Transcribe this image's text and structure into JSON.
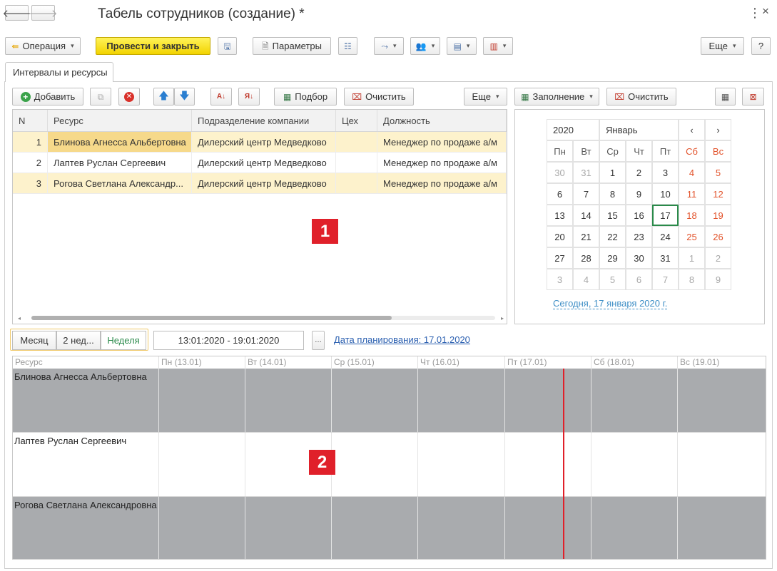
{
  "window": {
    "title": "Табель сотрудников (создание) *"
  },
  "toolbar": {
    "operation": "Операция",
    "post_close": "Провести и закрыть",
    "params": "Параметры",
    "more": "Еще",
    "help": "?"
  },
  "tabs": [
    {
      "label": "Интервалы и ресурсы"
    }
  ],
  "table_toolbar": {
    "add": "Добавить",
    "selection": "Подбор",
    "clear": "Очистить",
    "more": "Еще",
    "fill": "Заполнение",
    "clear2": "Очистить"
  },
  "table": {
    "columns": [
      "N",
      "Ресурс",
      "Подразделение компании",
      "Цех",
      "Должность"
    ],
    "rows": [
      {
        "n": "1",
        "resource": "Блинова Агнесса Альбертовна",
        "dept": "Дилерский центр Медведково",
        "shop": "",
        "position": "Менеджер по продаже а/м"
      },
      {
        "n": "2",
        "resource": "Лаптев Руслан Сергеевич",
        "dept": "Дилерский центр Медведково",
        "shop": "",
        "position": "Менеджер по продаже а/м"
      },
      {
        "n": "3",
        "resource": "Рогова Светлана Александр...",
        "dept": "Дилерский центр Медведково",
        "shop": "",
        "position": "Менеджер по продаже а/м"
      }
    ]
  },
  "markers": {
    "m1": "1",
    "m2": "2"
  },
  "calendar": {
    "year": "2020",
    "month": "Январь",
    "prev": "‹",
    "next": "›",
    "weekdays": [
      "Пн",
      "Вт",
      "Ср",
      "Чт",
      "Пт",
      "Сб",
      "Вс"
    ],
    "weeks": [
      [
        "30",
        "31",
        "1",
        "2",
        "3",
        "4",
        "5"
      ],
      [
        "6",
        "7",
        "8",
        "9",
        "10",
        "11",
        "12"
      ],
      [
        "13",
        "14",
        "15",
        "16",
        "17",
        "18",
        "19"
      ],
      [
        "20",
        "21",
        "22",
        "23",
        "24",
        "25",
        "26"
      ],
      [
        "27",
        "28",
        "29",
        "30",
        "31",
        "1",
        "2"
      ],
      [
        "3",
        "4",
        "5",
        "6",
        "7",
        "8",
        "9"
      ]
    ],
    "selected": "17",
    "today_link": "Сегодня, 17 января 2020 г."
  },
  "period": {
    "month": "Месяц",
    "two_weeks": "2 нед...",
    "week": "Неделя",
    "range": "13:01:2020 - 19:01:2020",
    "planning_date": "Дата планирования: 17.01.2020"
  },
  "timeline": {
    "resource_header": "Ресурс",
    "days": [
      "Пн (13.01)",
      "Вт (14.01)",
      "Ср (15.01)",
      "Чт (16.01)",
      "Пт (17.01)",
      "Сб (18.01)",
      "Вс (19.01)"
    ],
    "rows": [
      "Блинова Агнесса Альбертовна",
      "Лаптев Руслан Сергеевич",
      "Рогова Светлана Александровна"
    ]
  },
  "colors": {
    "accent_yellow": "#f2d300",
    "row_highlight": "#fdf2cc",
    "weekend": "#e2522a",
    "now_line": "#e0202a",
    "timeline_gray": "#a9abae"
  }
}
